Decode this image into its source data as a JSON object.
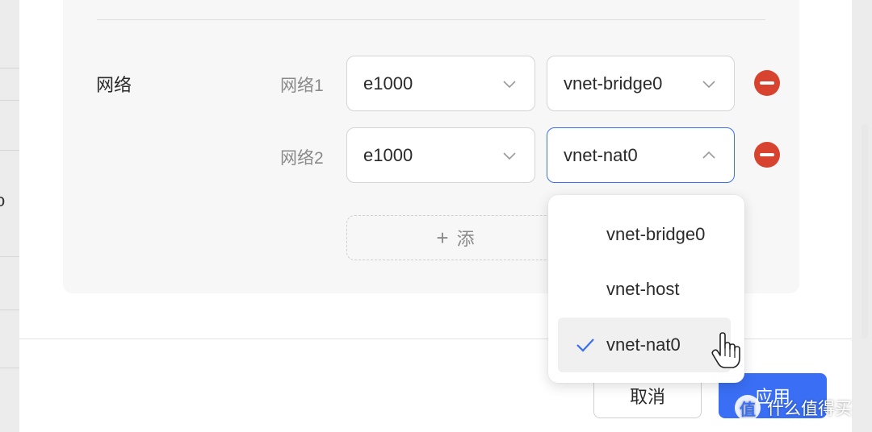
{
  "background": {
    "edge_glyph": "o"
  },
  "network": {
    "section_label": "网络",
    "rows": [
      {
        "label": "网络1",
        "model": "e1000",
        "interface": "vnet-bridge0"
      },
      {
        "label": "网络2",
        "model": "e1000",
        "interface": "vnet-nat0"
      }
    ],
    "add_label": "添"
  },
  "dropdown": {
    "options": [
      {
        "label": "vnet-bridge0",
        "selected": false
      },
      {
        "label": "vnet-host",
        "selected": false
      },
      {
        "label": "vnet-nat0",
        "selected": true
      }
    ]
  },
  "footer": {
    "cancel_label": "取消",
    "apply_label": "应用"
  },
  "watermark": {
    "icon_text": "值",
    "text": "什么值得买"
  },
  "colors": {
    "accent": "#3a6ff5",
    "danger": "#d8432f"
  },
  "icons": {
    "chevron_down": "chevron-down-icon",
    "chevron_up": "chevron-up-icon",
    "remove": "minus-circle-icon",
    "check": "check-icon",
    "cursor": "hand-pointer-icon"
  }
}
